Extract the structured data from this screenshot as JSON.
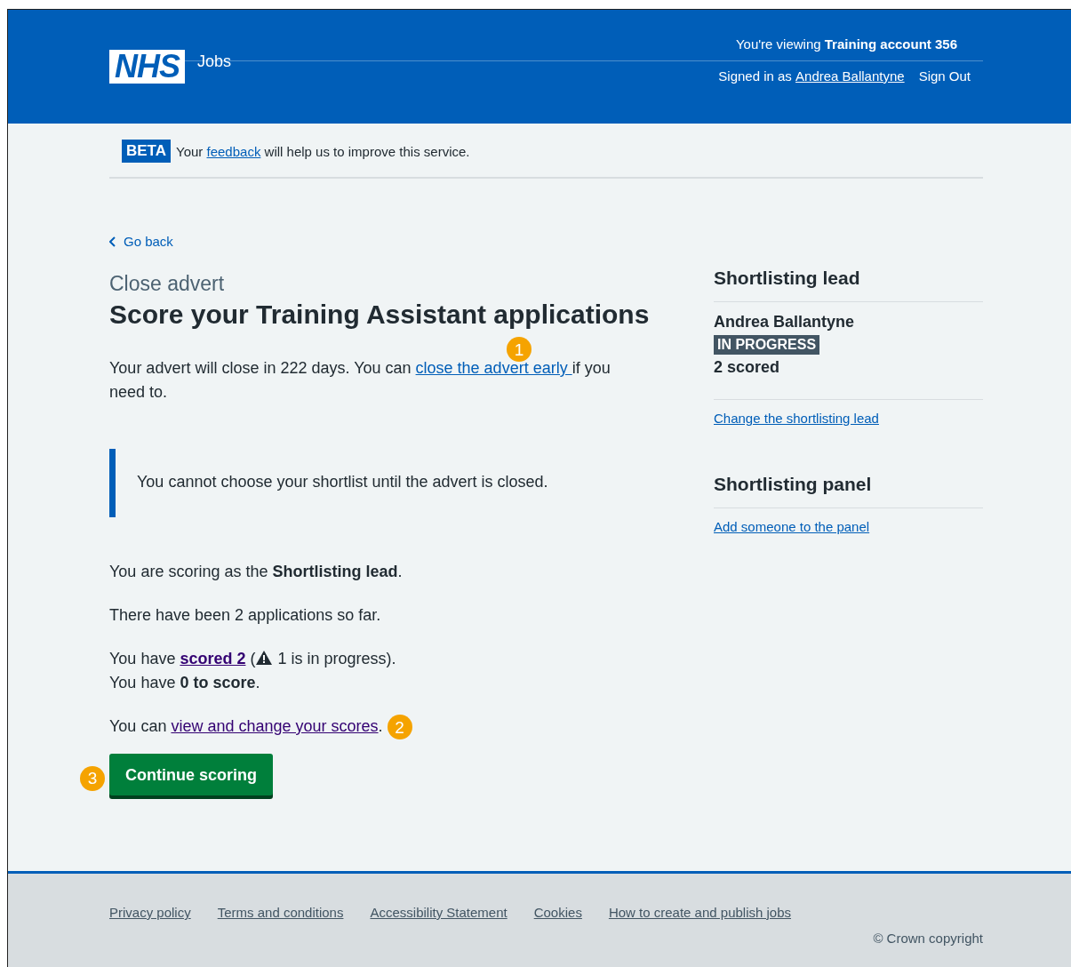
{
  "header": {
    "logo": "NHS",
    "service": "Jobs",
    "viewing_prefix": "You're viewing ",
    "viewing_account": "Training account 356",
    "signed_in_prefix": "Signed in as ",
    "user": "Andrea Ballantyne",
    "sign_out": "Sign Out"
  },
  "beta": {
    "tag": "BETA",
    "before": "Your ",
    "link": "feedback",
    "after": " will help us to improve this service."
  },
  "back_link": "Go back",
  "caption": "Close advert",
  "title": "Score your Training Assistant applications",
  "advert_notice": {
    "before": "Your advert will close in 222 days. You can ",
    "link": "close the advert early ",
    "after": "if you need to.",
    "callout": "1"
  },
  "inset": "You cannot choose your shortlist until the advert is closed.",
  "role_text": "You are scoring as the **Shortlisting lead**.",
  "applications_text": "There have been 2 applications so far.",
  "scored": {
    "before": "You have ",
    "link": "scored 2",
    "open": " (",
    "after": " 1 is in progress).",
    "to_score": "You have **0 to score**."
  },
  "scores": {
    "before": "You can ",
    "link": "view and change your scores",
    "after": ".",
    "callout": "2"
  },
  "continue_button": {
    "label": "Continue scoring",
    "callout": "3"
  },
  "sidebar": {
    "lead_heading": "Shortlisting lead",
    "lead_name": "Andrea Ballantyne",
    "status": "IN PROGRESS",
    "scored": "2 scored",
    "change_link": "Change the shortlisting lead",
    "panel_heading": "Shortlisting panel",
    "panel_link": "Add someone to the panel"
  },
  "footer": {
    "links": [
      "Privacy policy",
      "Terms and conditions",
      "Accessibility Statement",
      "Cookies",
      "How to create and publish jobs"
    ],
    "copyright": "© Crown copyright"
  }
}
